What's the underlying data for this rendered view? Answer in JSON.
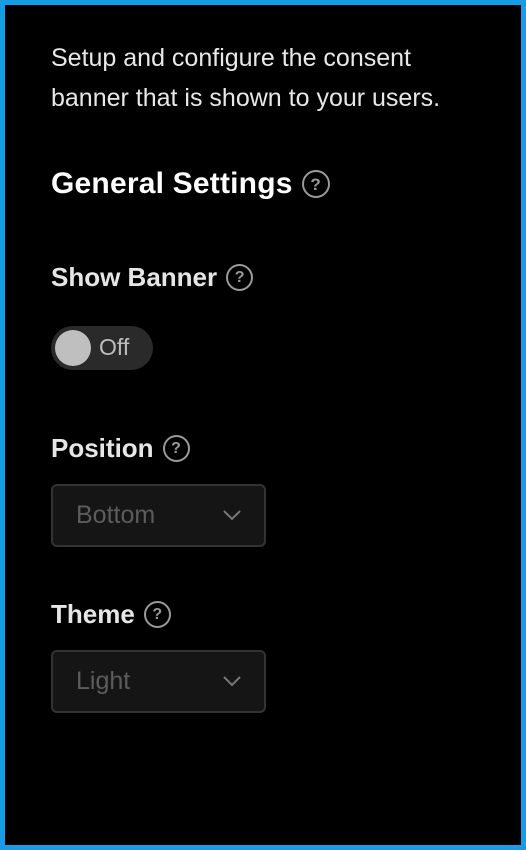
{
  "panel": {
    "description": "Setup and configure the consent banner that is shown to your users."
  },
  "general_settings": {
    "heading": "General Settings",
    "help_icon_glyph": "?"
  },
  "show_banner": {
    "label": "Show Banner",
    "help_icon_glyph": "?",
    "toggle_state_label": "Off",
    "toggle_on": false
  },
  "position": {
    "label": "Position",
    "help_icon_glyph": "?",
    "selected_value": "Bottom"
  },
  "theme": {
    "label": "Theme",
    "help_icon_glyph": "?",
    "selected_value": "Light"
  },
  "icons": {
    "help": "help-circle-icon",
    "chevron": "chevron-down-icon"
  },
  "colors": {
    "frame_border": "#1a9be8",
    "background": "#000000",
    "text": "#e8e8e8",
    "muted": "#9a9a9a"
  }
}
